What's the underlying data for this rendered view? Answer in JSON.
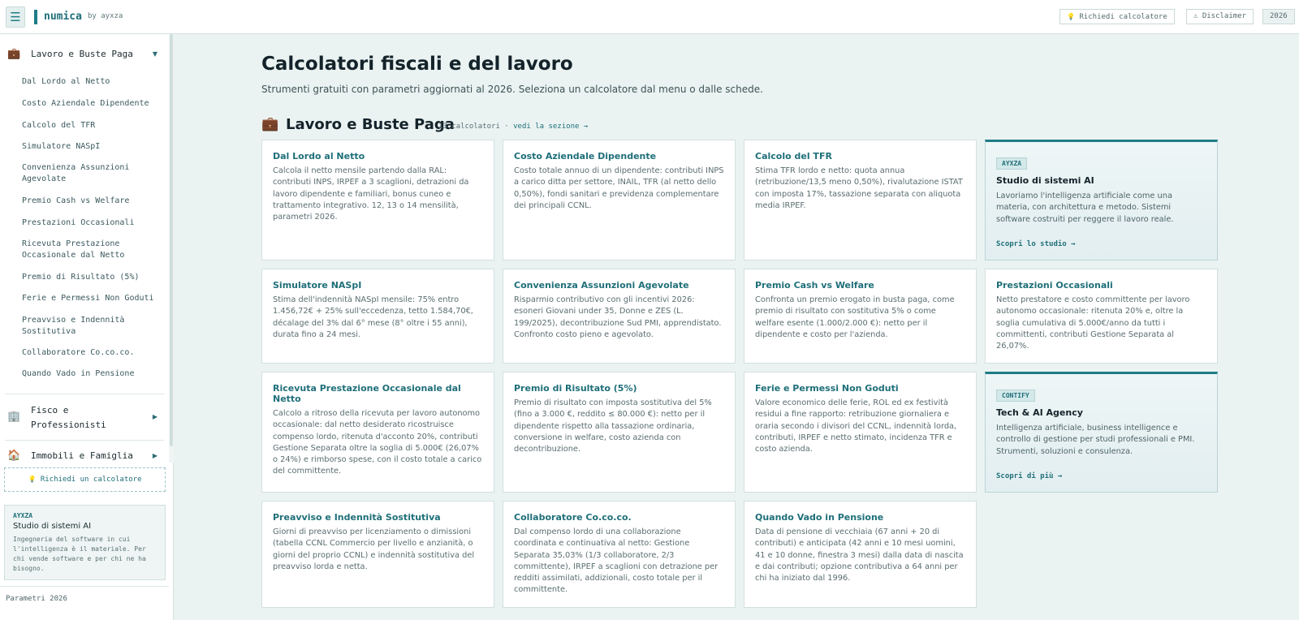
{
  "header": {
    "menu_icon": "☰",
    "brand": "numica",
    "brand_by": "by ayxza",
    "request_label": "Richiedi calcolatore",
    "request_icon": "💡",
    "disclaimer_label": "Disclaimer",
    "disclaimer_icon": "⚠",
    "year": "2026"
  },
  "sidebar": {
    "categories": [
      {
        "label": "Lavoro e Buste Paga",
        "icon": "💼",
        "arrow": "▼"
      },
      {
        "label": "Fisco e Professionisti",
        "icon": "🏢",
        "arrow": "▶"
      },
      {
        "label": "Immobili e Famiglia",
        "icon": "🏠",
        "arrow": "▶"
      }
    ],
    "items": [
      "Dal Lordo al Netto",
      "Costo Aziendale Dipendente",
      "Calcolo del TFR",
      "Simulatore NASpI",
      "Convenienza Assunzioni Agevolate",
      "Premio Cash vs Welfare",
      "Prestazioni Occasionali",
      "Ricevuta Prestazione Occasionale dal Netto",
      "Premio di Risultato (5%)",
      "Ferie e Permessi Non Goduti",
      "Preavviso e Indennità Sostitutiva",
      "Collaboratore Co.co.co.",
      "Quando Vado in Pensione"
    ],
    "request_label": "Richiedi un calcolatore",
    "request_icon": "💡",
    "promo": {
      "tag": "AYXZA",
      "title": "Studio di sistemi AI",
      "text": "Ingegneria del software in cui l'intelligenza è il materiale. Per chi vende software e per chi ne ha bisogno."
    },
    "footer": "Parametri 2026"
  },
  "main": {
    "title": "Calcolatori fiscali e del lavoro",
    "subtitle": "Strumenti gratuiti con parametri aggiornati al 2026. Seleziona un calcolatore dal menu o dalle schede.",
    "section": {
      "icon": "💼",
      "title": "Lavoro e Buste Paga",
      "count": "13 calcolatori",
      "separator": "·",
      "link": "vedi la sezione →"
    },
    "cards": [
      {
        "title": "Dal Lordo al Netto",
        "desc": "Calcola il netto mensile partendo dalla RAL: contributi INPS, IRPEF a 3 scaglioni, detrazioni da lavoro dipendente e familiari, bonus cuneo e trattamento integrativo. 12, 13 o 14 mensilità, parametri 2026."
      },
      {
        "title": "Costo Aziendale Dipendente",
        "desc": "Costo totale annuo di un dipendente: contributi INPS a carico ditta per settore, INAIL, TFR (al netto dello 0,50%), fondi sanitari e previdenza complementare dei principali CCNL."
      },
      {
        "title": "Calcolo del TFR",
        "desc": "Stima TFR lordo e netto: quota annua (retribuzione/13,5 meno 0,50%), rivalutazione ISTAT con imposta 17%, tassazione separata con aliquota media IRPEF."
      },
      {
        "title": "Simulatore NASpI",
        "desc": "Stima dell'indennità NASpI mensile: 75% entro 1.456,72€ + 25% sull'eccedenza, tetto 1.584,70€, décalage del 3% dal 6° mese (8° oltre i 55 anni), durata fino a 24 mesi."
      },
      {
        "title": "Convenienza Assunzioni Agevolate",
        "desc": "Risparmio contributivo con gli incentivi 2026: esoneri Giovani under 35, Donne e ZES (L. 199/2025), decontribuzione Sud PMI, apprendistato. Confronto costo pieno e agevolato."
      },
      {
        "title": "Premio Cash vs Welfare",
        "desc": "Confronta un premio erogato in busta paga, come premio di risultato con sostitutiva 5% o come welfare esente (1.000/2.000 €): netto per il dipendente e costo per l'azienda."
      },
      {
        "title": "Prestazioni Occasionali",
        "desc": "Netto prestatore e costo committente per lavoro autonomo occasionale: ritenuta 20% e, oltre la soglia cumulativa di 5.000€/anno da tutti i committenti, contributi Gestione Separata al 26,07%."
      },
      {
        "title": "Ricevuta Prestazione Occasionale dal Netto",
        "desc": "Calcolo a ritroso della ricevuta per lavoro autonomo occasionale: dal netto desiderato ricostruisce compenso lordo, ritenuta d'acconto 20%, contributi Gestione Separata oltre la soglia di 5.000€ (26,07% o 24%) e rimborso spese, con il costo totale a carico del committente."
      },
      {
        "title": "Premio di Risultato (5%)",
        "desc": "Premio di risultato con imposta sostitutiva del 5% (fino a 3.000 €, reddito ≤ 80.000 €): netto per il dipendente rispetto alla tassazione ordinaria, conversione in welfare, costo azienda con decontribuzione."
      },
      {
        "title": "Ferie e Permessi Non Goduti",
        "desc": "Valore economico delle ferie, ROL ed ex festività residui a fine rapporto: retribuzione giornaliera e oraria secondo i divisori del CCNL, indennità lorda, contributi, IRPEF e netto stimato, incidenza TFR e costo azienda."
      },
      {
        "title": "Preavviso e Indennità Sostitutiva",
        "desc": "Giorni di preavviso per licenziamento o dimissioni (tabella CCNL Commercio per livello e anzianità, o giorni del proprio CCNL) e indennità sostitutiva del preavviso lorda e netta."
      },
      {
        "title": "Collaboratore Co.co.co.",
        "desc": "Dal compenso lordo di una collaborazione coordinata e continuativa al netto: Gestione Separata 35,03% (1/3 collaboratore, 2/3 committente), IRPEF a scaglioni con detrazione per redditi assimilati, addizionali, costo totale per il committente."
      },
      {
        "title": "Quando Vado in Pensione",
        "desc": "Data di pensione di vecchiaia (67 anni + 20 di contributi) e anticipata (42 anni e 10 mesi uomini, 41 e 10 donne, finestra 3 mesi) dalla data di nascita e dai contributi; opzione contributiva a 64 anni per chi ha iniziato dal 1996."
      }
    ],
    "promos": [
      {
        "tag": "AYXZA",
        "title": "Studio di sistemi AI",
        "text": "Lavoriamo l'intelligenza artificiale come una materia, con architettura e metodo. Sistemi software costruiti per reggere il lavoro reale.",
        "link": "Scopri lo studio →"
      },
      {
        "tag": "CONTIFY",
        "title": "Tech & AI Agency",
        "text": "Intelligenza artificiale, business intelligence e controllo di gestione per studi professionali e PMI. Strumenti, soluzioni e consulenza.",
        "link": "Scopri di più →"
      }
    ]
  },
  "colors": {
    "accent": "#1f7c87",
    "page_bg": "#eaf3f2",
    "card_bg": "#ffffff"
  }
}
